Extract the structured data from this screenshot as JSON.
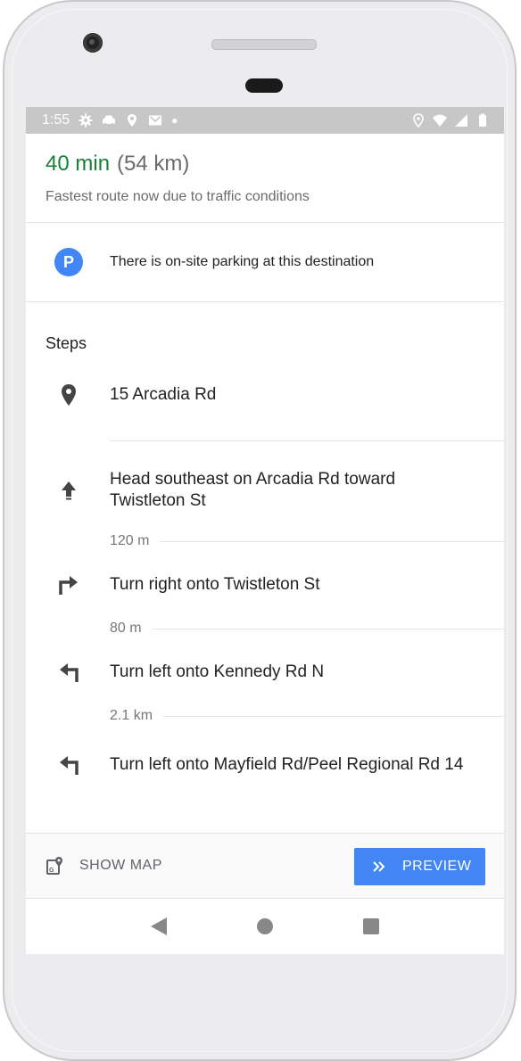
{
  "status_bar": {
    "time": "1:55",
    "left_icons": [
      "gear-icon",
      "car-icon",
      "location-pin-icon",
      "gmail-icon",
      "dot-icon"
    ],
    "right_icons": [
      "location-icon",
      "wifi-icon",
      "signal-icon",
      "battery-icon"
    ]
  },
  "summary": {
    "time": "40 min",
    "distance": "(54 km)",
    "note": "Fastest route now due to traffic conditions"
  },
  "parking": {
    "icon_letter": "P",
    "text": "There is on-site parking at this destination"
  },
  "steps_title": "Steps",
  "steps": [
    {
      "icon": "location-pin-icon",
      "text": "15 Arcadia Rd"
    },
    {
      "icon": "arrow-straight-icon",
      "text": "Head southeast on Arcadia Rd toward Twistleton St",
      "distance_after": "120 m"
    },
    {
      "icon": "turn-right-icon",
      "text": "Turn right onto Twistleton St",
      "distance_after": "80 m"
    },
    {
      "icon": "turn-left-icon",
      "text": "Turn left onto Kennedy Rd N",
      "distance_after": "2.1 km"
    },
    {
      "icon": "turn-left-icon",
      "text": "Turn left onto Mayfield Rd/Peel Regional Rd 14"
    }
  ],
  "bottom_bar": {
    "show_map_label": "SHOW MAP",
    "preview_label": "PREVIEW"
  },
  "colors": {
    "accent_blue": "#4285f4",
    "time_green": "#188038",
    "status_bar_bg": "#c7c7c7"
  }
}
